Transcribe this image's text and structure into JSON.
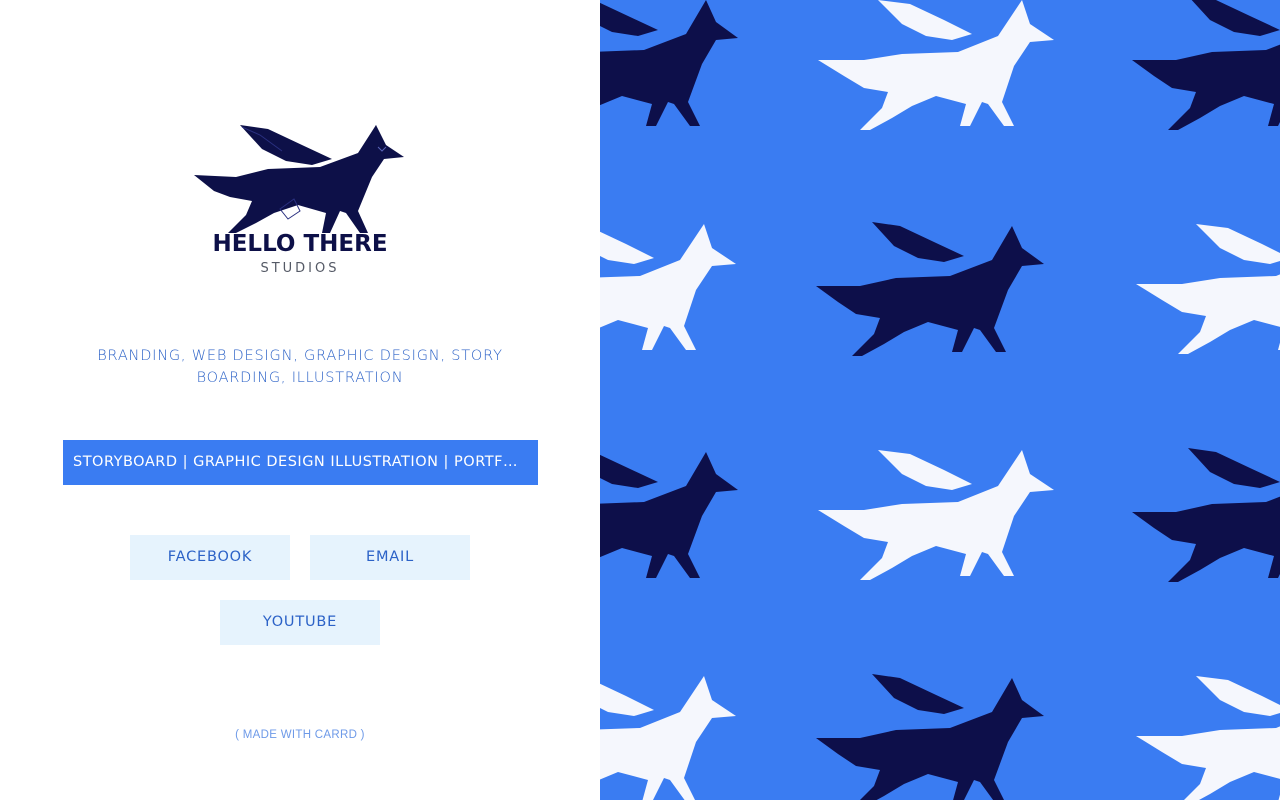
{
  "brand": {
    "name": "HELLO THERE",
    "subtitle": "STUDIOS",
    "logo_icon": "winged-fox-logo"
  },
  "tagline": "BRANDING, WEB DESIGN, GRAPHIC DESIGN, STORY BOARDING, ILLUSTRATION",
  "portfolio_button": "STORYBOARD | GRAPHIC DESIGN ILLUSTRATION | PORTFOLIO",
  "social": {
    "facebook": "FACEBOOK",
    "email": "EMAIL",
    "youtube": "YOUTUBE"
  },
  "credit": "( MADE WITH CARRD )",
  "pattern": {
    "background_color": "#3a7cf2",
    "fox_dark_color": "#0d0f4a",
    "fox_light_color": "#f5f7fd",
    "icon": "winged-fox-pattern"
  },
  "colors": {
    "accent": "#3a7cf2",
    "text_blue": "#2c62c7",
    "button_light": "#e6f3fd",
    "logo_navy": "#0d1048"
  }
}
